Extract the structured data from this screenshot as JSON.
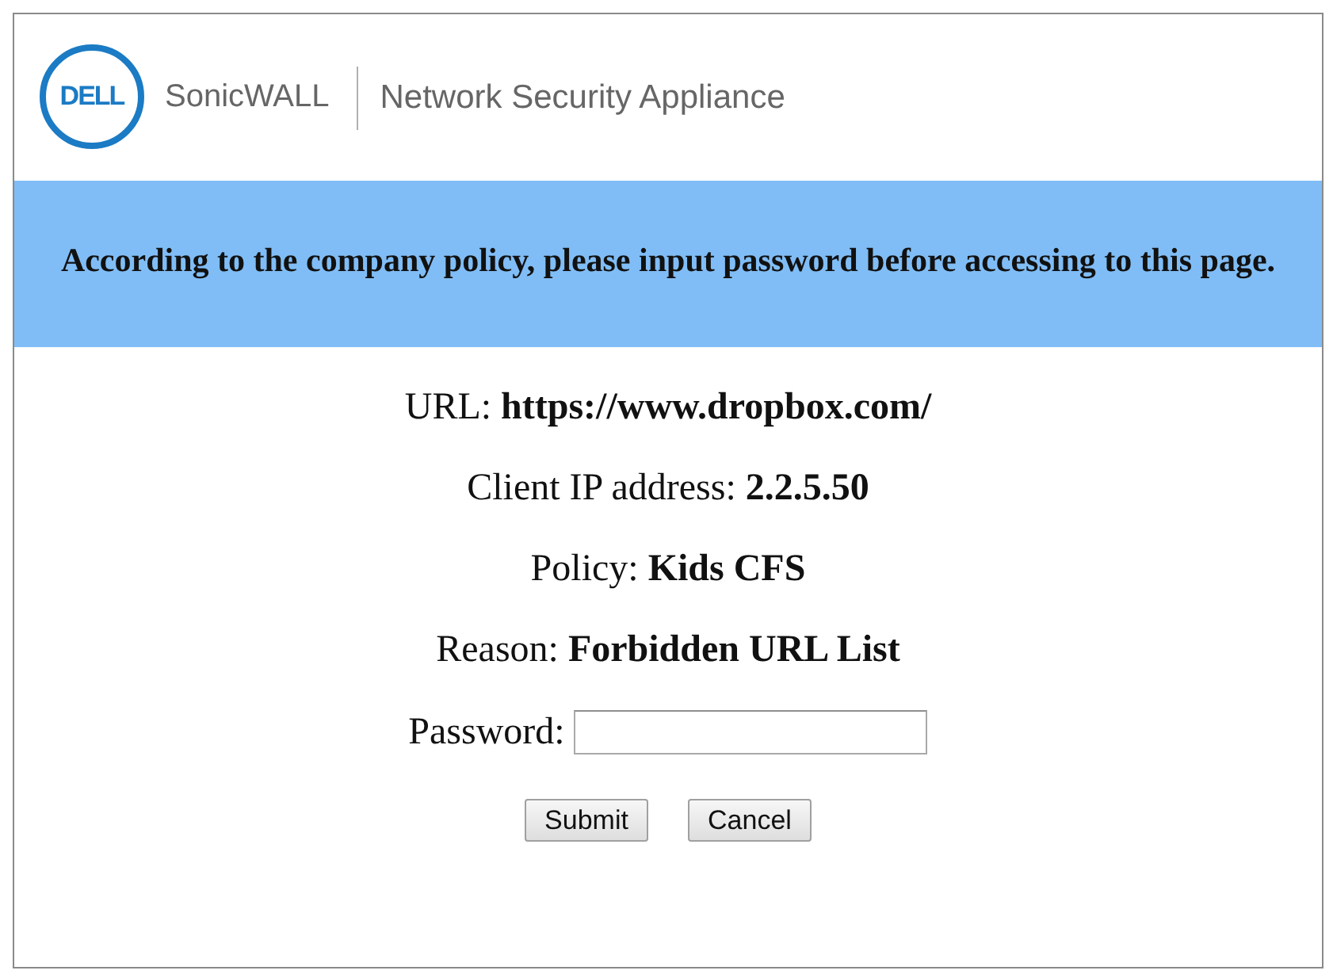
{
  "header": {
    "logo_text": "DELL",
    "product": "SonicWALL",
    "subtitle": "Network Security Appliance"
  },
  "banner": {
    "message": "According to the company policy, please input password before accessing to this page."
  },
  "details": [
    "URL: **https://www.dropbox.com/**",
    "Client IP address: **2.2.5.50**",
    "Policy: **Kids CFS**",
    "Reason: **Forbidden URL List**"
  ],
  "password": {
    "label": "Password:"
  },
  "buttons": [
    "Submit",
    "Cancel"
  ]
}
